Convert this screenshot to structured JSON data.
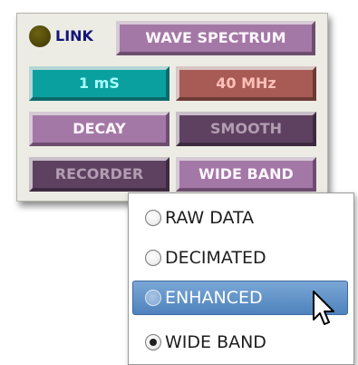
{
  "panel": {
    "link_label": "LINK",
    "link_led_color": "#504809",
    "buttons": {
      "wave_spectrum": "WAVE SPECTRUM",
      "time_value": "1 mS",
      "frequency_value": "40 MHz",
      "decay": "DECAY",
      "smooth": "SMOOTH",
      "recorder": "RECORDER",
      "wide_band": "WIDE BAND"
    }
  },
  "mode_menu": {
    "items": [
      {
        "label": "RAW DATA",
        "selected": false
      },
      {
        "label": "DECIMATED",
        "selected": false
      },
      {
        "label": "ENHANCED",
        "selected": false,
        "hovered": true
      },
      {
        "label": "WIDE BAND",
        "selected": true
      }
    ]
  },
  "colors": {
    "button_purple": "#a478a6",
    "button_dark_purple": "#5e4160",
    "button_teal": "#0aa0a0",
    "button_red": "#a85b55",
    "menu_highlight": "#5b8fc6",
    "link_text": "#14147c"
  }
}
